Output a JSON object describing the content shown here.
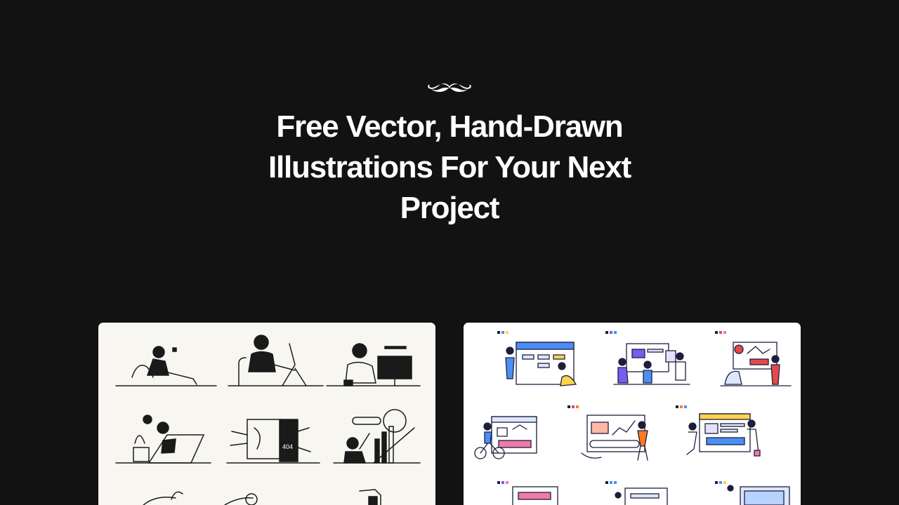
{
  "hero": {
    "logo_icon": "mustache-icon",
    "headline": "Free Vector, Hand-Drawn Illustrations For Your Next Project"
  },
  "cards": [
    {
      "name": "black-and-white-illustration-pack",
      "preview_badge": "404"
    },
    {
      "name": "colorful-illustration-pack"
    }
  ],
  "colors": {
    "background": "#121212",
    "headline": "#ffffff",
    "card_left_bg": "#f7f6f1",
    "card_right_bg": "#ffffff",
    "accent_blue": "#4a8ff5",
    "accent_purple": "#7a5cf0",
    "accent_pink": "#f07aa8",
    "accent_orange": "#ff7a21",
    "accent_yellow": "#ffd34d",
    "accent_red": "#e5484d"
  }
}
